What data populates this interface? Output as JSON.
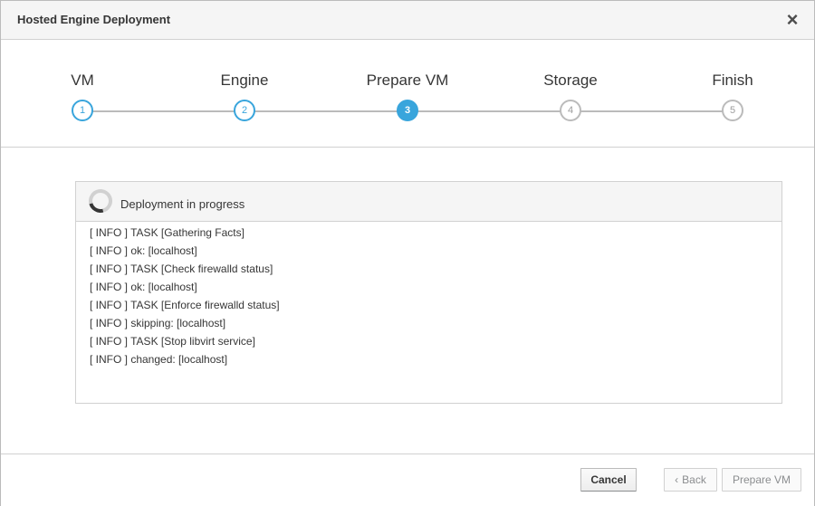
{
  "dialog": {
    "title": "Hosted Engine Deployment",
    "close_icon": "close-icon"
  },
  "wizard": {
    "steps": [
      {
        "label": "VM",
        "number": "1",
        "state": "done"
      },
      {
        "label": "Engine",
        "number": "2",
        "state": "done"
      },
      {
        "label": "Prepare VM",
        "number": "3",
        "state": "active"
      },
      {
        "label": "Storage",
        "number": "4",
        "state": "pending"
      },
      {
        "label": "Finish",
        "number": "5",
        "state": "pending"
      }
    ]
  },
  "progress": {
    "title": "Deployment in progress",
    "icon": "spinner-icon",
    "log": [
      "[ INFO ] TASK [Gathering Facts]",
      "[ INFO ] ok: [localhost]",
      "[ INFO ] TASK [Check firewalld status]",
      "[ INFO ] ok: [localhost]",
      "[ INFO ] TASK [Enforce firewalld status]",
      "[ INFO ] skipping: [localhost]",
      "[ INFO ] TASK [Stop libvirt service]",
      "[ INFO ] changed: [localhost]"
    ]
  },
  "footer": {
    "cancel_label": "Cancel",
    "back_label": "Back",
    "next_label": "Prepare VM"
  },
  "colors": {
    "accent": "#39a5dc",
    "border": "#d1d1d1",
    "header_bg": "#f5f5f5"
  }
}
